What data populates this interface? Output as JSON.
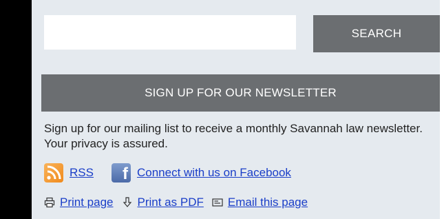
{
  "search": {
    "input_value": "",
    "input_placeholder": "",
    "button_label": "SEARCH"
  },
  "newsletter": {
    "header": "SIGN UP FOR OUR NEWSLETTER",
    "description": "Sign up for our mailing list to receive a monthly Savannah law newsletter. Your privacy is assured."
  },
  "social": {
    "rss_label": "RSS",
    "rss_icon": "rss-icon",
    "facebook_label": "Connect with us on Facebook",
    "facebook_icon": "facebook-icon"
  },
  "tools": {
    "print_label": "Print page",
    "print_icon": "printer-icon",
    "pdf_label": "Print as PDF",
    "pdf_icon": "download-arrow-icon",
    "email_label": "Email this page",
    "email_icon": "envelope-icon"
  },
  "colors": {
    "panel_bg": "#e5eaef",
    "bar_gray": "#6b6e71",
    "link_blue": "#1a3ec8",
    "left_bar": "#000000"
  }
}
